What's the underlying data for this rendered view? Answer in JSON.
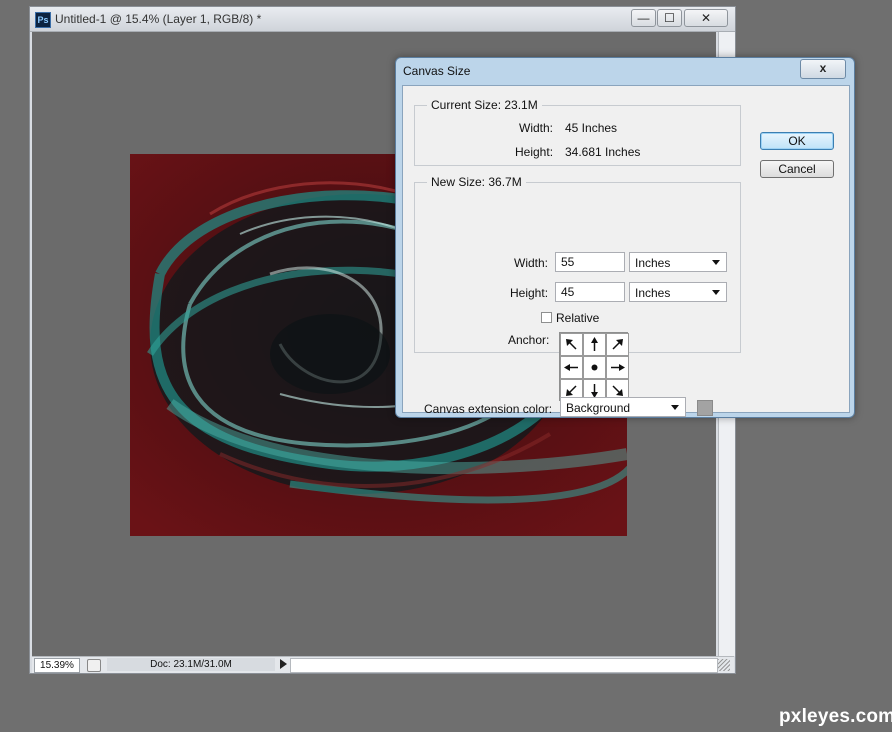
{
  "document": {
    "title": "Untitled-1 @ 15.4% (Layer 1, RGB/8) *",
    "app_icon_text": "Ps",
    "window_buttons": {
      "minimize": "—",
      "maximize": "☐",
      "close": "✕"
    },
    "zoom": "15.39%",
    "doc_info": "Doc: 23.1M/31.0M"
  },
  "dialog": {
    "title": "Canvas Size",
    "close_glyph": "x",
    "current_size": {
      "title": "Current Size: 23.1M",
      "width_label": "Width:",
      "width_value": "45 Inches",
      "height_label": "Height:",
      "height_value": "34.681 Inches"
    },
    "new_size": {
      "title": "New Size: 36.7M",
      "width_label": "Width:",
      "width_value": "55",
      "width_unit": "Inches",
      "height_label": "Height:",
      "height_value": "45",
      "height_unit": "Inches",
      "relative_label": "Relative",
      "relative_checked": false,
      "anchor_label": "Anchor:",
      "anchor_selected": "center"
    },
    "extension_color_label": "Canvas extension color:",
    "extension_color_value": "Background",
    "extension_swatch_color": "#a3a3a3",
    "ok_label": "OK",
    "cancel_label": "Cancel"
  },
  "watermark": "pxleyes.com"
}
